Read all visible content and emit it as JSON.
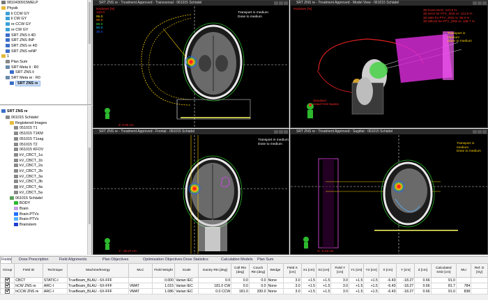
{
  "tree_top": {
    "patient_id": "0810430915MELP",
    "items": [
      {
        "label": "Physik",
        "indent": 0,
        "icon": "folder-icon"
      },
      {
        "label": "li CCW GY",
        "indent": 1,
        "icon": "beam-icon"
      },
      {
        "label": "li CW GY",
        "indent": 1,
        "icon": "beam-icon"
      },
      {
        "label": "re CCW GY",
        "indent": 1,
        "icon": "beam-icon"
      },
      {
        "label": "re CW GY",
        "indent": 1,
        "icon": "beam-icon"
      },
      {
        "label": "SRT ZNS li 4D",
        "indent": 1,
        "icon": "plan-icon"
      },
      {
        "label": "SRT ZNS INP",
        "indent": 1,
        "icon": "plan-icon"
      },
      {
        "label": "SRT ZNS re 4D",
        "indent": 1,
        "icon": "plan-icon"
      },
      {
        "label": "SRT ZNS reNP",
        "indent": 1,
        "icon": "plan-icon"
      },
      {
        "label": "1",
        "indent": 0,
        "icon": "folder-icon"
      },
      {
        "label": "Plan Sum",
        "indent": 1,
        "icon": "sum-icon"
      },
      {
        "label": "SRT Meta li : R0",
        "indent": 1,
        "icon": "course-icon"
      },
      {
        "label": "SRT ZNS li",
        "indent": 2,
        "icon": "plan-icon"
      },
      {
        "label": "SRT Meta re : R0",
        "indent": 1,
        "icon": "course-icon"
      },
      {
        "label": "SRT ZNS re",
        "indent": 2,
        "icon": "plan-icon",
        "selected": true
      }
    ]
  },
  "tree_bot": {
    "title": "SRT ZNS re",
    "items": [
      {
        "label": "061015 Schädel",
        "indent": 1,
        "icon": "image-icon"
      },
      {
        "label": "Registered Images",
        "indent": 2,
        "icon": "folder-icon"
      },
      {
        "label": "051015 T1",
        "indent": 3,
        "icon": "image-icon"
      },
      {
        "label": "051015 T1KM",
        "indent": 3,
        "icon": "image-icon"
      },
      {
        "label": "051015 T1sag",
        "indent": 3,
        "icon": "image-icon"
      },
      {
        "label": "051015 T2",
        "indent": 3,
        "icon": "image-icon"
      },
      {
        "label": "061015 KFOV",
        "indent": 3,
        "icon": "image-icon"
      },
      {
        "label": "kV_CBCT_1a",
        "indent": 3,
        "icon": "image-icon"
      },
      {
        "label": "kV_CBCT_1b",
        "indent": 3,
        "icon": "image-icon"
      },
      {
        "label": "kV_CBCT_2a",
        "indent": 3,
        "icon": "image-icon"
      },
      {
        "label": "kV_CBCT_2b",
        "indent": 3,
        "icon": "image-icon"
      },
      {
        "label": "kV_CBCT_3a",
        "indent": 3,
        "icon": "image-icon"
      },
      {
        "label": "kV_CBCT_3b",
        "indent": 3,
        "icon": "image-icon"
      },
      {
        "label": "kV_CBCT_4a",
        "indent": 3,
        "icon": "image-icon"
      },
      {
        "label": "kV_CBCT_5a",
        "indent": 3,
        "icon": "image-icon"
      },
      {
        "label": "061015 Schädel",
        "indent": 2,
        "icon": "structure-set-icon"
      },
      {
        "label": "BODY",
        "indent": 3,
        "icon": "structure-icon",
        "color": "#2db82d"
      },
      {
        "label": "Brain",
        "indent": 3,
        "icon": "structure-icon",
        "color": "#c8a0e8"
      },
      {
        "label": "Brain-PTVs",
        "indent": 3,
        "icon": "structure-icon",
        "color": "#1e6fff"
      },
      {
        "label": "Brain-PTVs",
        "indent": 3,
        "icon": "structure-icon",
        "color": "#4fb0ff"
      },
      {
        "label": "Brainstem",
        "indent": 3,
        "icon": "structure-icon",
        "color": "#1f3fd0"
      }
    ]
  },
  "viewports": {
    "transversal": {
      "title": "SRT ZNS re - Treatment Approved - Transversal - 061015 Schädel",
      "legend_title": "Isodoses [%]",
      "legend": [
        {
          "value": "120.0",
          "color": "#ff2020"
        },
        {
          "value": "95.0",
          "color": "#ffe000"
        },
        {
          "value": "90.0",
          "color": "#ff8c00"
        },
        {
          "value": "80.0",
          "color": "#39e639"
        },
        {
          "value": "50.0",
          "color": "#00c8ff"
        },
        {
          "value": "30.0",
          "color": "#2060ff"
        }
      ],
      "note": "Transport in medium\nDose to medium",
      "coord": "Z: 0.00 cm"
    },
    "model": {
      "title": "SRT ZNS re - Treatment Approved - Model View - 061015 Schädel",
      "legend_title": "Isodoses [%]",
      "stats": [
        "3D Dose MAX: 121.8 %",
        "3D MAX for PTV_ZNS re: 121.8 %",
        "3D MIN for PTV_ZNS re: 95.0 %",
        "3D MEAN for PTV_ZNS re: 108.7 %"
      ],
      "note": "Transport in\nmedium\nDose to medium",
      "orientation": "Standard\nHead First-Supine"
    },
    "frontal": {
      "title": "SRT ZNS re - Treatment Approved - Frontal - 061015 Schädel",
      "note": "Transport in medium\nDose to medium",
      "coord": "Y: -18.27 cm"
    },
    "sagittal": {
      "title": "SRT ZNS re - Treatment Approved - Sagittal - 061015 Schädel",
      "note": "Transport in\nmedium\nDose to medium",
      "coord": "X: -6.43 cm"
    }
  },
  "tabs": [
    {
      "label": "Fields",
      "active": true
    },
    {
      "label": "Dose Prescription"
    },
    {
      "label": "Field Alignments"
    },
    {
      "label": "Plan Objectives"
    },
    {
      "label": "Optimization Objectives"
    },
    {
      "label": "Dose Statistics"
    },
    {
      "label": "Calculation Models"
    },
    {
      "label": "Plan Sum"
    }
  ],
  "table": {
    "headers": [
      "Group",
      "Field ID",
      "Technique",
      "Machine/Energy",
      "MLC",
      "Field Weight",
      "Scale",
      "Gantry Rtn [deg]",
      "Coll Rtn [deg]",
      "Couch Rtn [deg]",
      "Wedge",
      "Field X [cm]",
      "X1 [cm]",
      "X2 [cm]",
      "Field Y [cm]",
      "Y1 [cm]",
      "Y2 [cm]",
      "X [cm]",
      "Y [cm]",
      "Z [cm]",
      "Calculated SSD [cm]",
      "MU",
      "Ref. D [Gy]"
    ],
    "rows": [
      [
        "",
        "CBCT",
        "STATIC-I",
        "TrueBeam_BLAU - 6X-FFF",
        "",
        "0.000",
        "Varian IEC",
        "0.0",
        "0.0",
        "0.0",
        "None",
        "3.0",
        "+1.5",
        "+1.5",
        "3.0",
        "+1.5",
        "+1.5",
        "-6.43",
        "-18.27",
        "0.66",
        "91.0",
        "",
        ""
      ],
      [
        "",
        "hCW ZNS re",
        "ARC-I",
        "TrueBeam_BLAU - 6X-FFF",
        "VMAT",
        "1.015",
        "Varian IEC",
        "181.0 CW",
        "0.0",
        "0.0",
        "None",
        "3.0",
        "+1.5",
        "+1.5",
        "3.0",
        "+1.5",
        "+1.5",
        "-6.43",
        "-18.27",
        "0.66",
        "81.7",
        "784",
        ""
      ],
      [
        "",
        "hCCW ZNS re",
        "ARC-I",
        "TrueBeam_BLAU - 6X-FFF",
        "VMAT",
        "1.086",
        "Varian IEC",
        "0.0 CCW",
        "181.0",
        "330.0",
        "None",
        "3.0",
        "+1.5",
        "+1.5",
        "3.0",
        "+1.5",
        "+1.5",
        "-6.43",
        "-18.27",
        "0.66",
        "91.0",
        "838",
        ""
      ]
    ]
  },
  "colors": {
    "isodose_red": "#ff2020",
    "note_yellow": "#ffd200",
    "ptv": "#e040ff",
    "body": "#2db82d"
  }
}
